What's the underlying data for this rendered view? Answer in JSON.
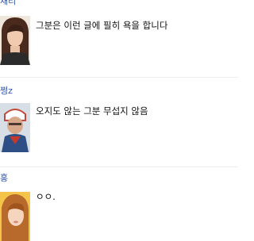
{
  "comments": [
    {
      "author": "채리",
      "text": "그분은 이런 글에 필히 욕을 합니다"
    },
    {
      "author": "쩡z",
      "text": "오지도 않는 그분 무섭지 않음"
    },
    {
      "author": "홍",
      "text": "ㅇㅇ."
    }
  ]
}
